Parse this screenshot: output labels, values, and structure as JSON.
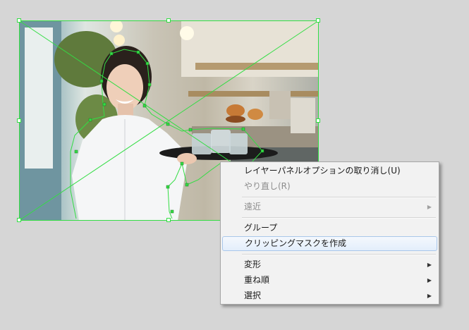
{
  "context_menu": {
    "items": [
      {
        "label": "レイヤーパネルオプションの取り消し(U)",
        "enabled": true,
        "submenu": false
      },
      {
        "label": "やり直し(R)",
        "enabled": false,
        "submenu": false
      },
      {
        "label": "遠近",
        "enabled": false,
        "submenu": true
      },
      {
        "label": "グループ",
        "enabled": true,
        "submenu": false
      },
      {
        "label": "クリッピングマスクを作成",
        "enabled": true,
        "submenu": false,
        "highlighted": true
      },
      {
        "label": "変形",
        "enabled": true,
        "submenu": true
      },
      {
        "label": "重ね順",
        "enabled": true,
        "submenu": true
      },
      {
        "label": "選択",
        "enabled": true,
        "submenu": true
      }
    ],
    "submenu_arrow": "▶"
  },
  "colors": {
    "selection": "#33dd44",
    "menu_highlight": "#a9c7ea",
    "canvas_background": "#d6d6d6"
  },
  "icons": {
    "submenu": "triangle-right-icon"
  }
}
